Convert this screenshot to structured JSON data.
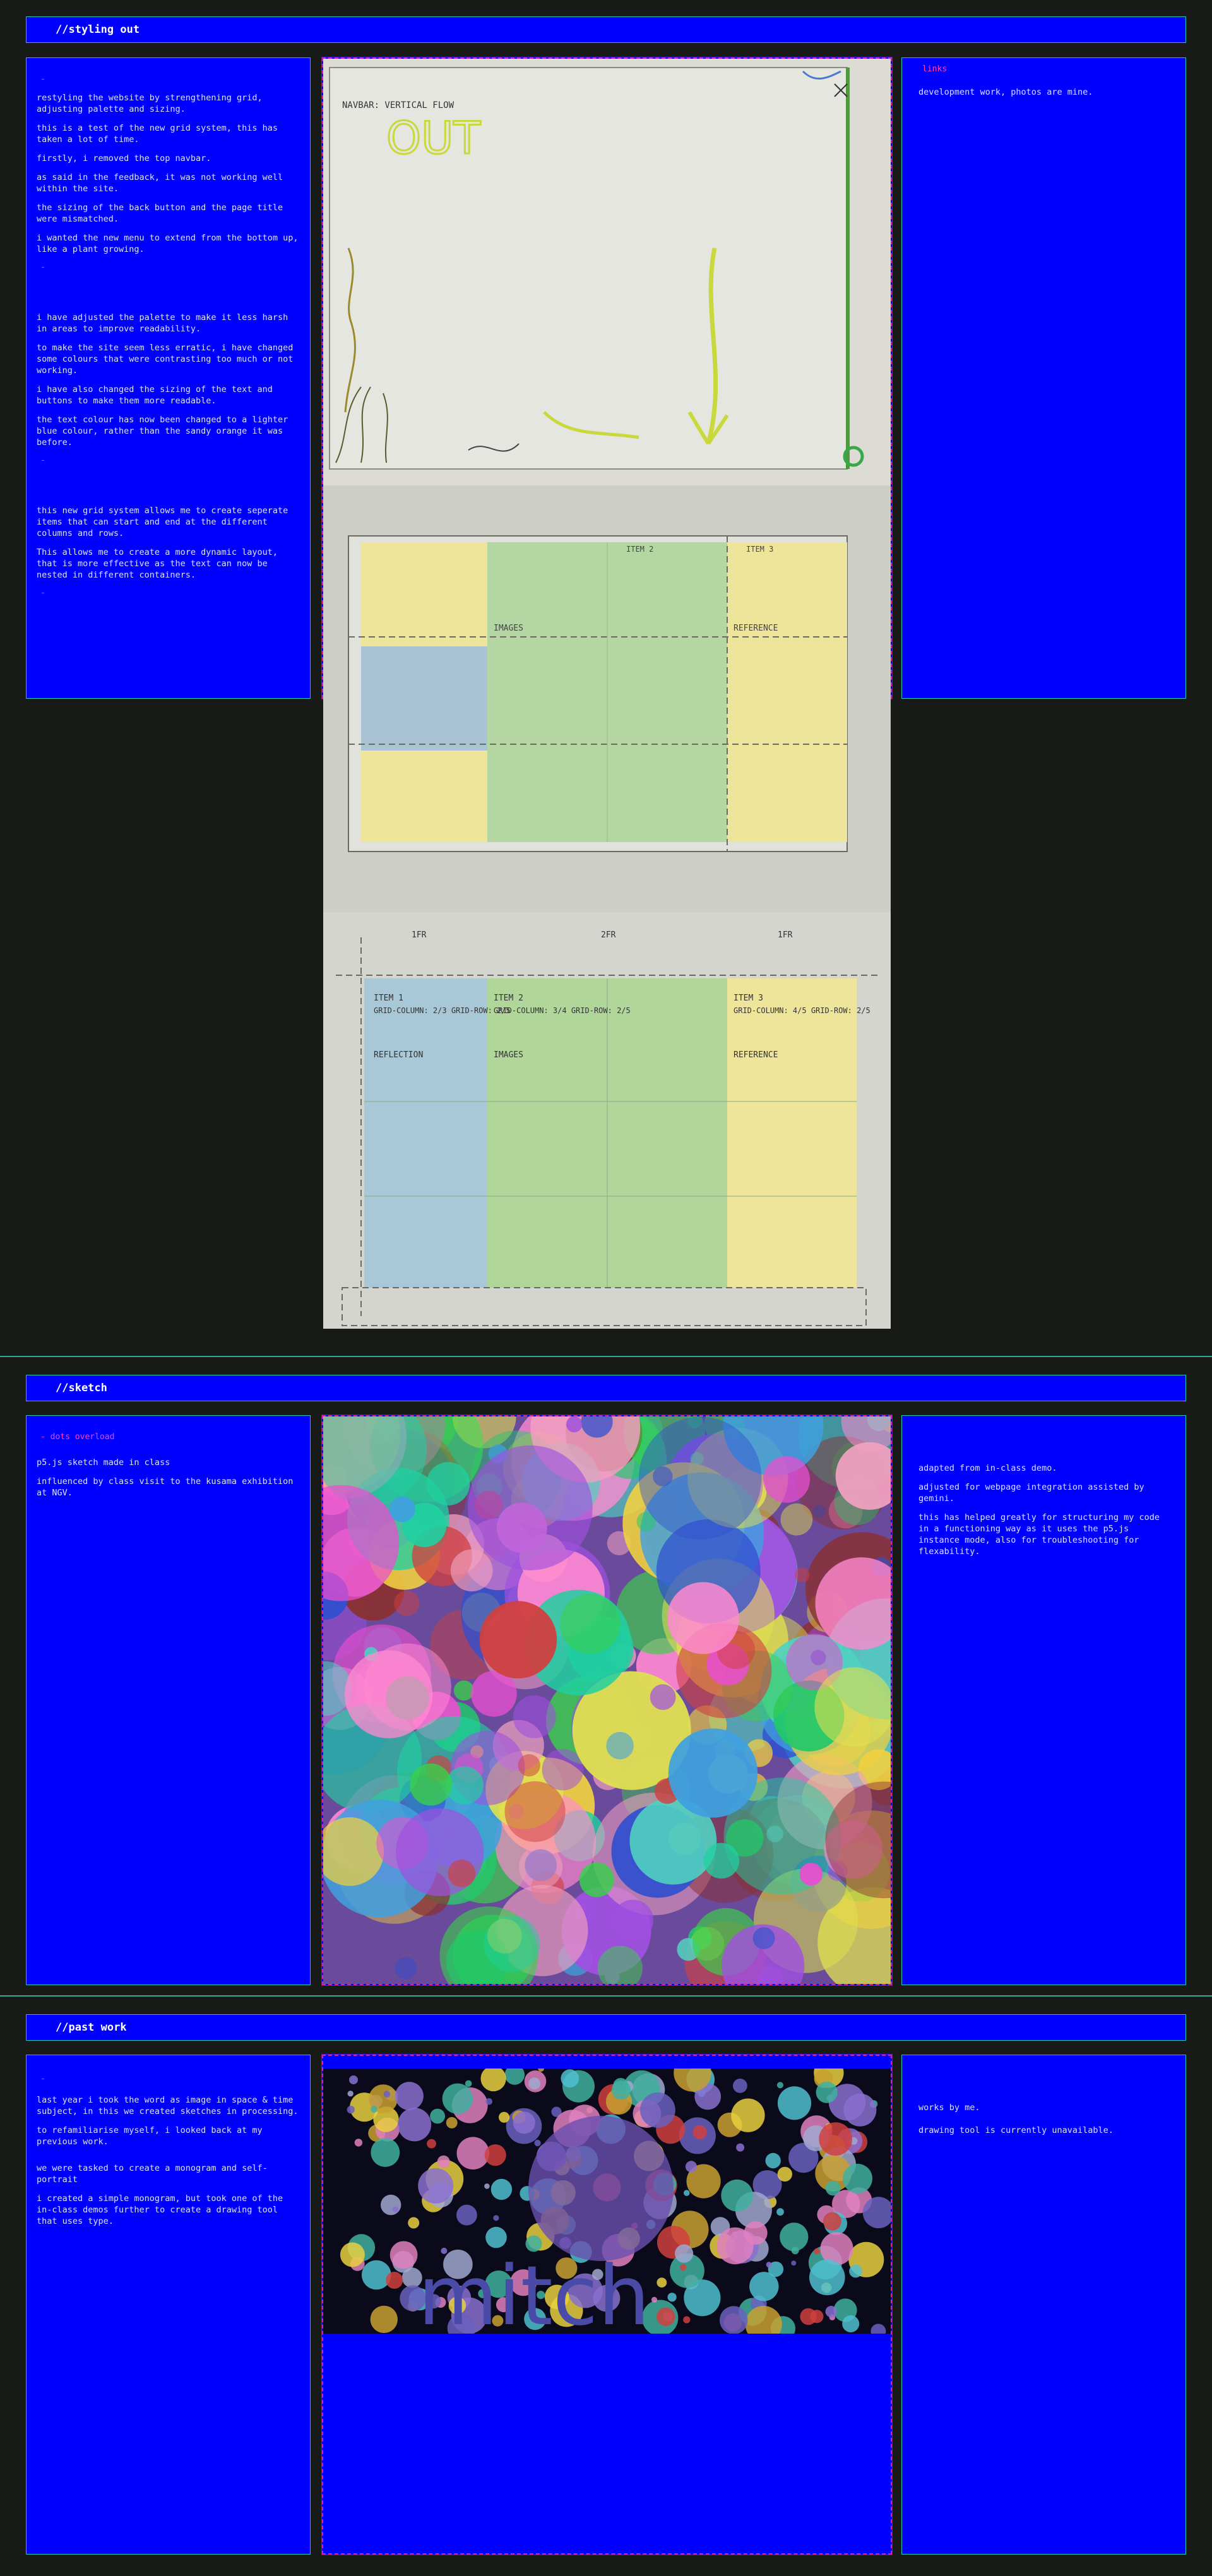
{
  "section1": {
    "title": "//styling out",
    "left": {
      "group1": [
        "restyling the website by strengthening grid, adjusting palette and sizing.",
        "this is a test of the new grid system, this has taken a lot of time.",
        "firstly, i removed the top navbar.",
        "as said in the feedback, it was not working well within the site.",
        "the sizing of the back button and the page title were mismatched.",
        "i wanted the new menu to extend from the bottom up, like a plant growing."
      ],
      "group2": [
        "i have adjusted the palette to make it less harsh in areas to improve readability.",
        "to make the site seem less erratic, i have changed some colours that were contrasting too much or not working.",
        "i have also changed the sizing of the text and buttons to make them more readable.",
        "the text colour has now been changed to a lighter blue colour, rather than the sandy orange it was before."
      ],
      "group3": [
        "this new grid system allows me to create seperate items that can start and end at the different columns and rows.",
        "This allows me to create a more dynamic layout, that is more effective as the text can now be nested in different containers."
      ],
      "dash": "-"
    },
    "right": {
      "link_label": "links",
      "note": "development work, photos are mine."
    }
  },
  "section2": {
    "title": "//sketch",
    "left": {
      "link_label": "- dots overload",
      "p1": "p5.js sketch made in class",
      "p2": "influenced by class visit to the kusama exhibition at NGV."
    },
    "right": {
      "p1": "adapted from in-class demo.",
      "p2": "adjusted for webpage integration assisted by gemini.",
      "p3": "this has helped greatly for structuring my code in a functioning way as it uses the p5.js instance mode, also for troubleshooting for flexability."
    }
  },
  "section3": {
    "title": "//past work",
    "left": {
      "dash": "-",
      "p1": "last year i took the word as image in space & time subject, in this we created sketches in processing.",
      "p2": "to refamiliarise myself, i looked back at my previous work.",
      "p3": "we were tasked to create a monogram and self-portrait",
      "p4": "i created a simple monogram, but took one of the in-class demos further to create a drawing tool that uses type."
    },
    "right": {
      "p1": "works by me.",
      "p2": "drawing tool is currently unavailable."
    },
    "artwork_text": "mitch"
  },
  "sketch_labels": {
    "top": "NAVBAR: VERTICAL FLOW",
    "out": "OUT",
    "item1": "ITEM 1",
    "item2": "ITEM 2",
    "item3": "ITEM 3",
    "grid1": "GRID-COLUMN: 2/3 GRID-ROW: 2/5",
    "grid2": "GRID-COLUMN: 3/4 GRID-ROW: 2/5",
    "grid3": "GRID-COLUMN: 4/5 GRID-ROW: 2/5",
    "reflection": "REFLECTION",
    "images": "IMAGES",
    "reference": "REFERENCE",
    "fr1": "1FR",
    "fr2": "2FR",
    "fr3": "1FR"
  },
  "colors": {
    "accent": "#0000ff",
    "page_bg": "#181a18",
    "border": "#23c6b0",
    "link": "#ff3fbf",
    "text": "#d8e2ff"
  }
}
